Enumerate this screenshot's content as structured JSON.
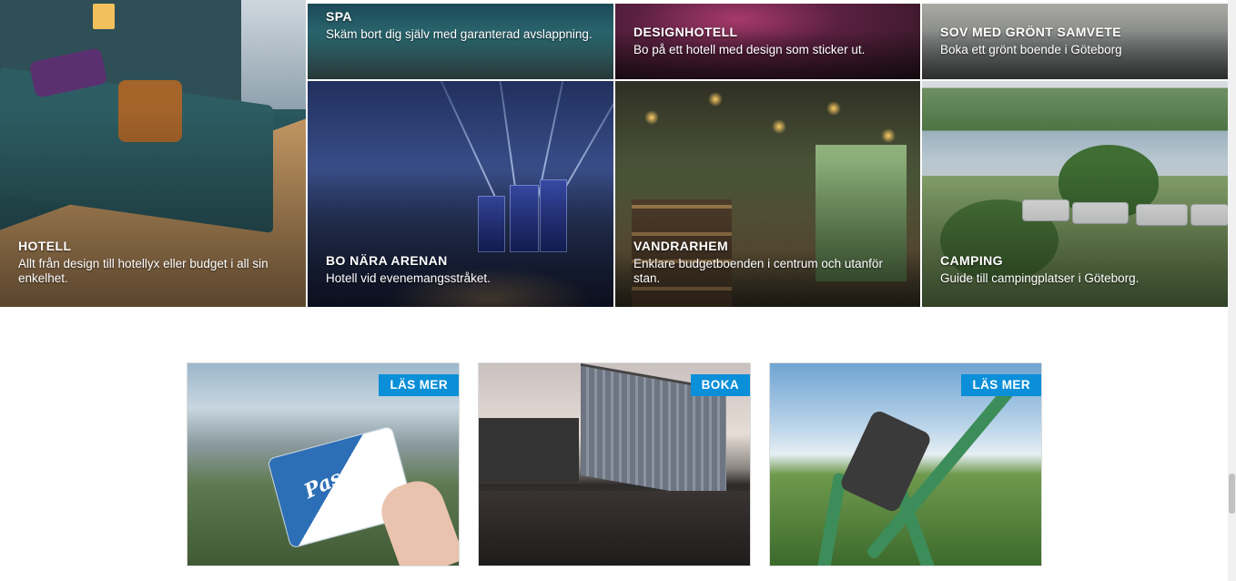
{
  "tiles": [
    {
      "title": "SPA",
      "desc": "Skäm bort dig själv med garanterad avslappning."
    },
    {
      "title": "DESIGNHOTELL",
      "desc": "Bo på ett hotell med design som sticker ut."
    },
    {
      "title": "SOV MED GRÖNT SAMVETE",
      "desc": "Boka ett grönt boende i Göteborg"
    },
    {
      "title": "HOTELL",
      "desc": "Allt från design till hotellyx eller budget i all sin enkelhet."
    },
    {
      "title": "BO NÄRA ARENAN",
      "desc": "Hotell vid evenemangsstråket."
    },
    {
      "title": "VANDRARHEM",
      "desc": "Enklare budgetboenden i centrum och utanför stan."
    },
    {
      "title": "CAMPING",
      "desc": "Guide till campingplatser i Göteborg."
    }
  ],
  "cards": [
    {
      "badge": "LÄS MER",
      "image_text": "Pass"
    },
    {
      "badge": "BOKA"
    },
    {
      "badge": "LÄS MER"
    }
  ],
  "colors": {
    "badge_bg": "#0a8fd8",
    "tile_text": "#ffffff",
    "page_bg": "#ffffff"
  }
}
